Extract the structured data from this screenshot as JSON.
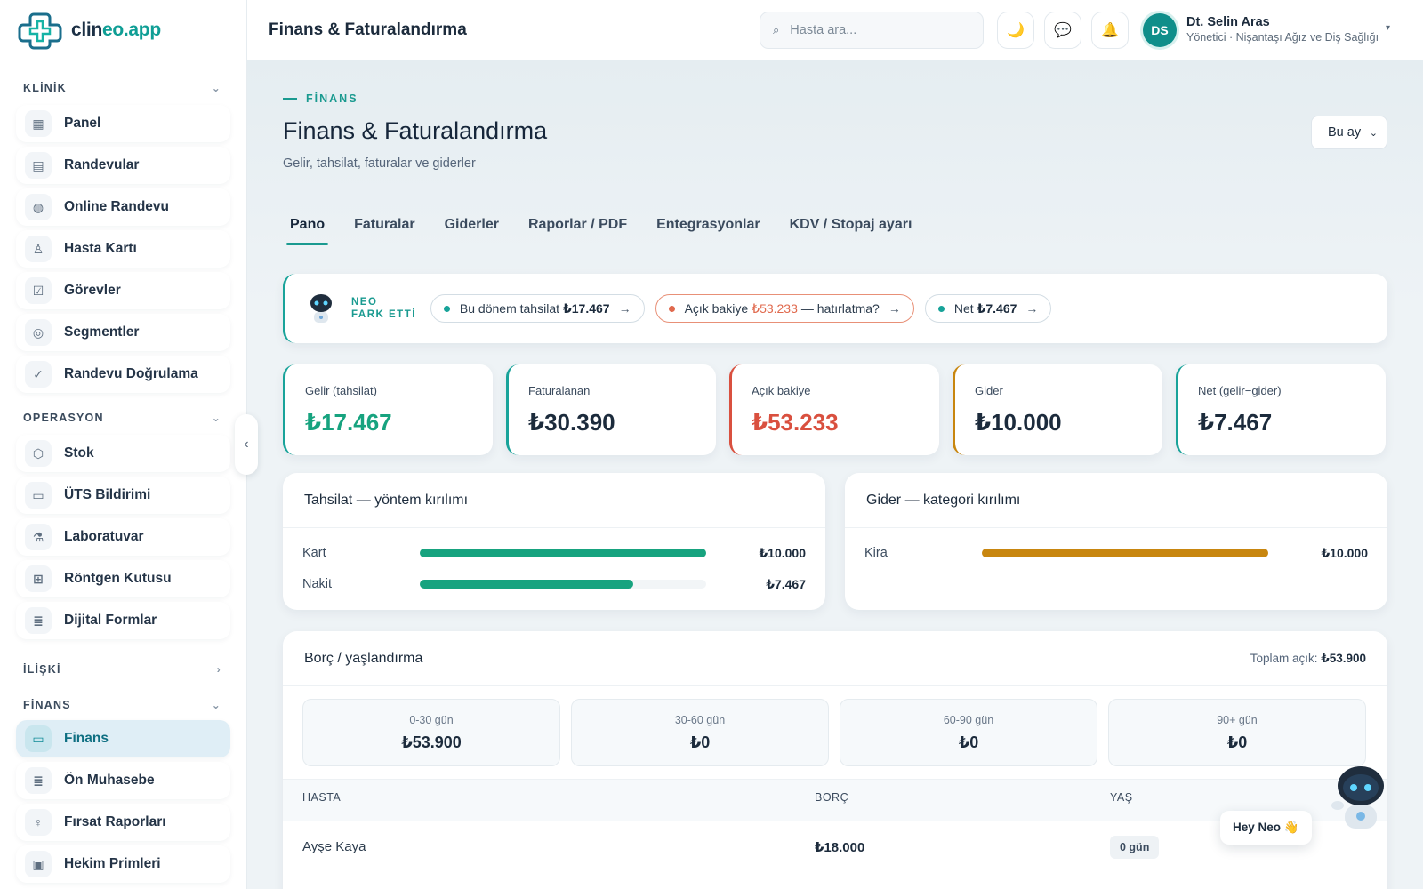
{
  "app": {
    "logo_name": "clin",
    "logo_accent": "eo.app",
    "brand_color": "#0f9e95"
  },
  "sidebar": {
    "sections": [
      {
        "label": "KLİNİK",
        "items": [
          "Panel",
          "Randevular",
          "Online Randevu",
          "Hasta Kartı",
          "Görevler",
          "Segmentler",
          "Randevu Doğrulama"
        ]
      },
      {
        "label": "OPERASYON",
        "items": [
          "Stok",
          "ÜTS Bildirimi",
          "Laboratuvar",
          "Röntgen Kutusu",
          "Dijital Formlar"
        ]
      },
      {
        "label": "İLİŞKİ"
      },
      {
        "label": "FİNANS",
        "items": [
          "Finans",
          "Ön Muhasebe",
          "Fırsat Raporları",
          "Hekim Primleri"
        ]
      }
    ],
    "active_item": "Finans"
  },
  "topbar": {
    "title": "Finans & Faturalandırma",
    "search_placeholder": "Hasta ara...",
    "user_initials": "DS",
    "user_name": "Dt. Selin Aras",
    "user_role": "Yönetici · Nişantaşı Ağız ve Diş Sağlığı"
  },
  "page": {
    "eyebrow": "FİNANS",
    "title": "Finans & Faturalandırma",
    "subtitle": "Gelir, tahsilat, faturalar ve giderler",
    "period": "Bu ay"
  },
  "tabs": [
    "Pano",
    "Faturalar",
    "Giderler",
    "Raporlar / PDF",
    "Entegrasyonlar",
    "KDV / Stopaj ayarı"
  ],
  "neo": {
    "label_line1": "NEO",
    "label_line2": "FARK ETTİ",
    "pill1_text": "Bu dönem tahsilat",
    "pill1_value": "₺17.467",
    "pill2_text": "Açık bakiye",
    "pill2_value": "₺53.233",
    "pill2_suffix": "— hatırlatma?",
    "pill3_text": "Net",
    "pill3_value": "₺7.467",
    "arrow": "→"
  },
  "kpis": [
    {
      "label": "Gelir (tahsilat)",
      "value": "₺17.467"
    },
    {
      "label": "Faturalanan",
      "value": "₺30.390"
    },
    {
      "label": "Açık bakiye",
      "value": "₺53.233"
    },
    {
      "label": "Gider",
      "value": "₺10.000"
    },
    {
      "label": "Net (gelir−gider)",
      "value": "₺7.467"
    }
  ],
  "collections": {
    "title": "Tahsilat — yöntem kırılımı",
    "rows": [
      {
        "name": "Kart",
        "amount": "₺10.000",
        "fraction": 1.0
      },
      {
        "name": "Nakit",
        "amount": "₺7.467",
        "fraction": 0.7467
      }
    ],
    "color": "#17a37f"
  },
  "expenses": {
    "title": "Gider — kategori kırılımı",
    "rows": [
      {
        "name": "Kira",
        "amount": "₺10.000",
        "fraction": 1.0
      }
    ],
    "color": "#c8860f"
  },
  "aging": {
    "title": "Borç / yaşlandırma",
    "total_label": "Toplam açık:",
    "total_value": "₺53.900",
    "buckets": [
      {
        "label": "0-30 gün",
        "value": "₺53.900"
      },
      {
        "label": "30-60 gün",
        "value": "₺0"
      },
      {
        "label": "60-90 gün",
        "value": "₺0"
      },
      {
        "label": "90+ gün",
        "value": "₺0"
      }
    ],
    "columns": [
      "HASTA",
      "BORÇ",
      "YAŞ"
    ],
    "rows": [
      {
        "patient": "Ayşe Kaya",
        "debt": "₺18.000",
        "age": "0 gün"
      }
    ]
  },
  "assistant": {
    "bubble": "Hey Neo 👋"
  }
}
